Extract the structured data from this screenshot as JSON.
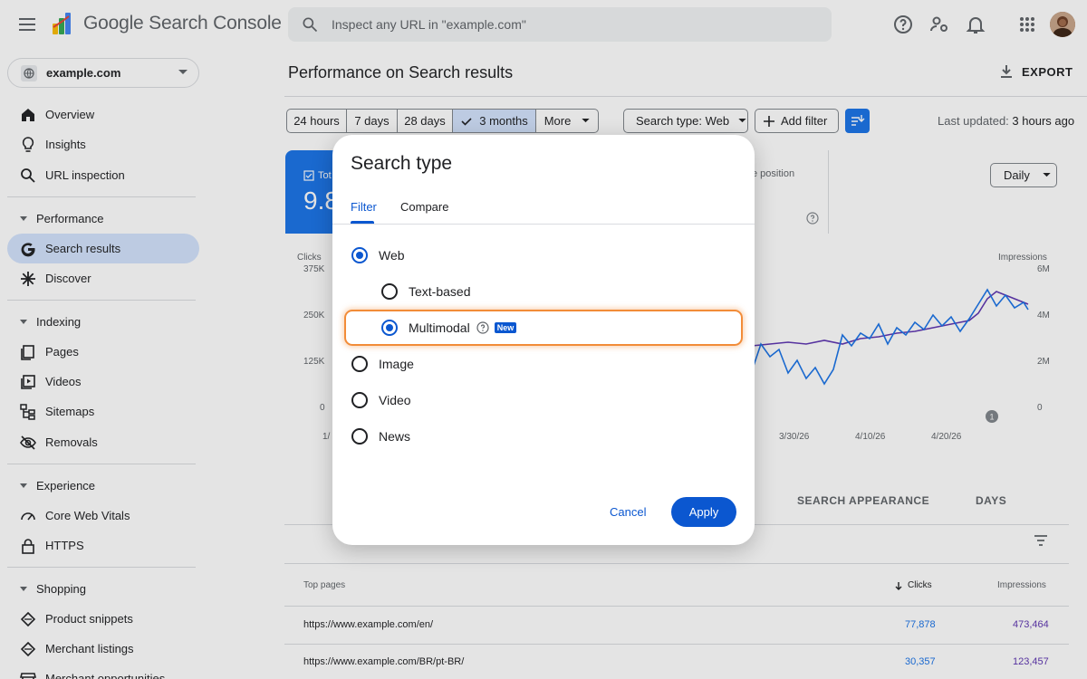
{
  "app": {
    "title": "Google Search Console"
  },
  "search": {
    "placeholder": "Inspect any URL in \"example.com\""
  },
  "property": {
    "name": "example.com"
  },
  "sidebar": {
    "top_items": [
      {
        "label": "Overview",
        "icon": "home-icon"
      },
      {
        "label": "Insights",
        "icon": "lightbulb-icon"
      },
      {
        "label": "URL inspection",
        "icon": "search-icon"
      }
    ],
    "sections": [
      {
        "title": "Performance",
        "items": [
          {
            "label": "Search results",
            "icon": "google-g-icon",
            "active": true
          },
          {
            "label": "Discover",
            "icon": "asterisk-icon"
          }
        ]
      },
      {
        "title": "Indexing",
        "items": [
          {
            "label": "Pages",
            "icon": "pages-icon"
          },
          {
            "label": "Videos",
            "icon": "video-icon"
          },
          {
            "label": "Sitemaps",
            "icon": "sitemap-icon"
          },
          {
            "label": "Removals",
            "icon": "eye-off-icon"
          }
        ]
      },
      {
        "title": "Experience",
        "items": [
          {
            "label": "Core Web Vitals",
            "icon": "speed-icon"
          },
          {
            "label": "HTTPS",
            "icon": "lock-icon"
          }
        ]
      },
      {
        "title": "Shopping",
        "items": [
          {
            "label": "Product snippets",
            "icon": "diamond-icon"
          },
          {
            "label": "Merchant listings",
            "icon": "diamond-icon"
          },
          {
            "label": "Merchant opportunities",
            "icon": "store-icon"
          }
        ]
      }
    ]
  },
  "main": {
    "title": "Performance on Search results",
    "export_label": "EXPORT",
    "date_ranges": [
      "24 hours",
      "7 days",
      "28 days",
      "3 months",
      "More"
    ],
    "active_range": "3 months",
    "search_type_chip": "Search type: Web",
    "add_filter": "Add filter",
    "last_updated_label": "Last updated:",
    "last_updated_value": "3 hours ago",
    "metric_total_label": "Tot",
    "metric_total_value": "9.8",
    "metric_position_label": "e position",
    "granularity": "Daily",
    "left_axis": {
      "title": "Clicks",
      "ticks": [
        "375K",
        "250K",
        "125K",
        "0"
      ]
    },
    "right_axis": {
      "title": "Impressions",
      "ticks": [
        "6M",
        "4M",
        "2M",
        "0"
      ]
    },
    "x_ticks": [
      "1/",
      "3/30/26",
      "4/10/26",
      "4/20/26"
    ],
    "annotation_marker": "1",
    "tabs": [
      "SEARCH APPEARANCE",
      "DAYS"
    ],
    "table": {
      "headers": {
        "page": "Top pages",
        "clicks": "Clicks",
        "impressions": "Impressions"
      },
      "rows": [
        {
          "page": "https://www.example.com/en/",
          "clicks": "77,878",
          "impressions": "473,464"
        },
        {
          "page": "https://www.example.com/BR/pt-BR/",
          "clicks": "30,357",
          "impressions": "123,457"
        }
      ]
    }
  },
  "dialog": {
    "title": "Search type",
    "tabs": {
      "filter": "Filter",
      "compare": "Compare"
    },
    "options": {
      "web": "Web",
      "text_based": "Text-based",
      "multimodal": "Multimodal",
      "new_badge": "New",
      "image": "Image",
      "video": "Video",
      "news": "News"
    },
    "selected": [
      "Web",
      "Multimodal"
    ],
    "cancel": "Cancel",
    "apply": "Apply"
  },
  "colors": {
    "accent": "#0b57d0",
    "clicks": "#1a73e8",
    "impressions": "#5e35b1",
    "highlight": "#f28c38"
  }
}
